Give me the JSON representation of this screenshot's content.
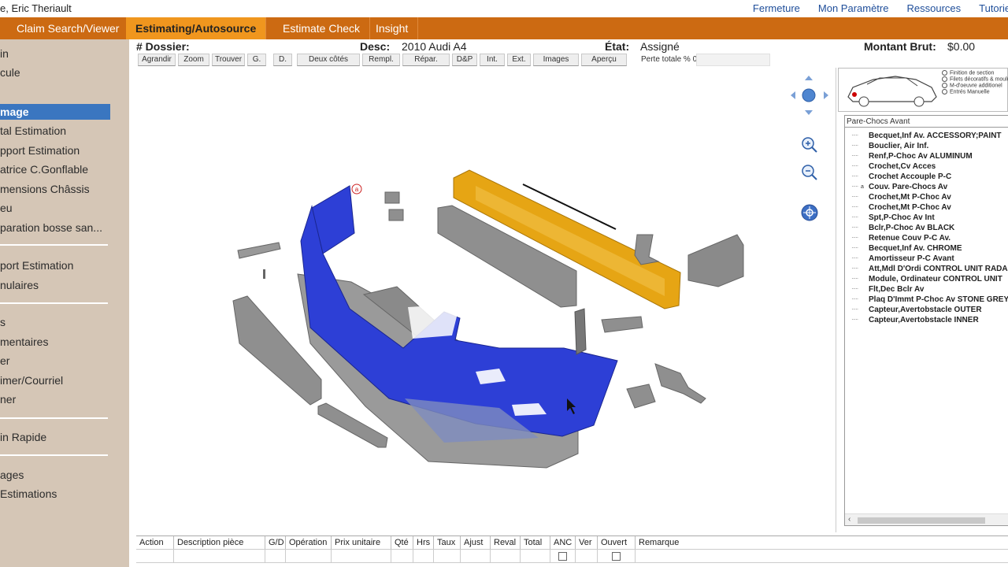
{
  "user": {
    "name": "e, Eric Theriault"
  },
  "top_links": [
    {
      "label": "Fermeture"
    },
    {
      "label": "Mon Paramètre"
    },
    {
      "label": "Ressources"
    },
    {
      "label": "Tutoriel"
    }
  ],
  "nav_tabs": [
    {
      "label": "Claim Search/Viewer",
      "active": false
    },
    {
      "label": "Estimating/Autosource",
      "active": true
    },
    {
      "label": "Estimate Check",
      "active": false
    },
    {
      "label": "Insight",
      "active": false
    }
  ],
  "sidebar": {
    "items": [
      {
        "label": "in"
      },
      {
        "label": "cule"
      },
      {
        "label": ""
      },
      {
        "label": "mage",
        "active": true
      },
      {
        "label": "tal Estimation"
      },
      {
        "label": "pport Estimation"
      },
      {
        "label": "atrice C.Gonflable"
      },
      {
        "label": "mensions Châssis"
      },
      {
        "label": "eu"
      },
      {
        "label": "paration bosse san..."
      },
      {
        "label": "port Estimation"
      },
      {
        "label": "nulaires"
      },
      {
        "label": "s"
      },
      {
        "label": "mentaires"
      },
      {
        "label": "er"
      },
      {
        "label": "imer/Courriel"
      },
      {
        "label": "ner"
      },
      {
        "label": "in Rapide"
      },
      {
        "label": "ages"
      },
      {
        "label": " Estimations"
      }
    ]
  },
  "header": {
    "dossier_label": "# Dossier:",
    "desc_label": "Desc:",
    "desc_value": "2010 Audi A4",
    "etat_label": "État:",
    "etat_value": "Assigné",
    "montant_label": "Montant Brut:",
    "montant_value": "$0.00"
  },
  "toolbar": {
    "buttons": [
      {
        "label": "Agrandir"
      },
      {
        "label": "Zoom"
      },
      {
        "label": "Trouver"
      },
      {
        "label": "G."
      },
      {
        "label": "D."
      },
      {
        "label": "Deux côtés"
      },
      {
        "label": "Rempl."
      },
      {
        "label": "Répar."
      },
      {
        "label": "D&P"
      },
      {
        "label": "Int."
      },
      {
        "label": "Ext."
      },
      {
        "label": "Images"
      },
      {
        "label": "Aperçu"
      }
    ],
    "perte_label": "Perte totale % 0"
  },
  "diagram": {
    "callout_letter": "a",
    "colors": {
      "selected": "#2d3fd6",
      "highlight": "#e6a514",
      "part": "#8f8f8f"
    }
  },
  "legend": {
    "items": [
      {
        "label": "Finition de section"
      },
      {
        "label": "Filets décoratifs & moulures"
      },
      {
        "label": "M-d'oeuvre additionel"
      },
      {
        "label": "Entrés Manuelle"
      }
    ]
  },
  "parts_panel": {
    "title": "Pare-Chocs Avant",
    "parts": [
      {
        "label": "Becquet,Inf Av. ACCESSORY;PAINT",
        "mark": ""
      },
      {
        "label": "Bouclier, Air Inf.",
        "mark": ""
      },
      {
        "label": "Renf,P-Choc Av ALUMINUM",
        "mark": ""
      },
      {
        "label": "Crochet,Cv Acces",
        "mark": ""
      },
      {
        "label": "Crochet Accouple P-C",
        "mark": ""
      },
      {
        "label": "Couv. Pare-Chocs Av",
        "mark": "a"
      },
      {
        "label": "Crochet,Mt P-Choc Av",
        "mark": ""
      },
      {
        "label": "Crochet,Mt P-Choc Av",
        "mark": ""
      },
      {
        "label": "Spt,P-Choc Av Int",
        "mark": ""
      },
      {
        "label": "Bclr,P-Choc Av BLACK",
        "mark": ""
      },
      {
        "label": "Retenue Couv P-C Av.",
        "mark": ""
      },
      {
        "label": "Becquet,Inf Av. CHROME",
        "mark": ""
      },
      {
        "label": "Amortisseur P-C Avant",
        "mark": ""
      },
      {
        "label": "Att,Mdl D'Ordi CONTROL UNIT RADAR",
        "mark": ""
      },
      {
        "label": "Module, Ordinateur CONTROL UNIT",
        "mark": ""
      },
      {
        "label": "Flt,Dec Bclr Av",
        "mark": ""
      },
      {
        "label": "Plaq D'Immt P-Choc Av STONE GREY",
        "mark": ""
      },
      {
        "label": "Capteur,Avertobstacle OUTER",
        "mark": ""
      },
      {
        "label": "Capteur,Avertobstacle INNER",
        "mark": ""
      }
    ]
  },
  "grid": {
    "columns": [
      {
        "label": "Action"
      },
      {
        "label": "Description pièce"
      },
      {
        "label": "G/D"
      },
      {
        "label": "Opération"
      },
      {
        "label": "Prix unitaire"
      },
      {
        "label": "Qté"
      },
      {
        "label": "Hrs"
      },
      {
        "label": "Taux"
      },
      {
        "label": "Ajust"
      },
      {
        "label": "Reval"
      },
      {
        "label": "Total"
      },
      {
        "label": "ANC"
      },
      {
        "label": "Ver"
      },
      {
        "label": "Ouvert"
      },
      {
        "label": "Remarque"
      }
    ]
  }
}
